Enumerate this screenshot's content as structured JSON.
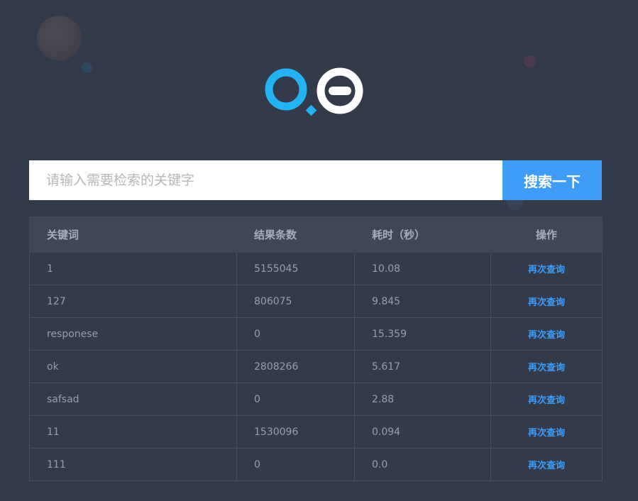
{
  "search": {
    "placeholder": "请输入需要检索的关键字",
    "button_label": "搜索一下"
  },
  "table": {
    "headers": [
      "关键词",
      "结果条数",
      "耗时（秒）",
      "操作"
    ],
    "rows": [
      {
        "keyword": "1",
        "count": "5155045",
        "time": "10.08",
        "action": "再次查询"
      },
      {
        "keyword": "127",
        "count": "806075",
        "time": "9.845",
        "action": "再次查询"
      },
      {
        "keyword": "responese",
        "count": "0",
        "time": "15.359",
        "action": "再次查询"
      },
      {
        "keyword": "ok",
        "count": "2808266",
        "time": "5.617",
        "action": "再次查询"
      },
      {
        "keyword": "safsad",
        "count": "0",
        "time": "2.88",
        "action": "再次查询"
      },
      {
        "keyword": "11",
        "count": "1530096",
        "time": "0.094",
        "action": "再次查询"
      },
      {
        "keyword": "111",
        "count": "0",
        "time": "0.0",
        "action": "再次查询"
      }
    ]
  },
  "colors": {
    "background": "#333a4a",
    "accent": "#3f9cf7",
    "logo_blue": "#24b3f2",
    "logo_white": "#ffffff"
  },
  "icons": {
    "logo": "qo-logo-icon"
  }
}
